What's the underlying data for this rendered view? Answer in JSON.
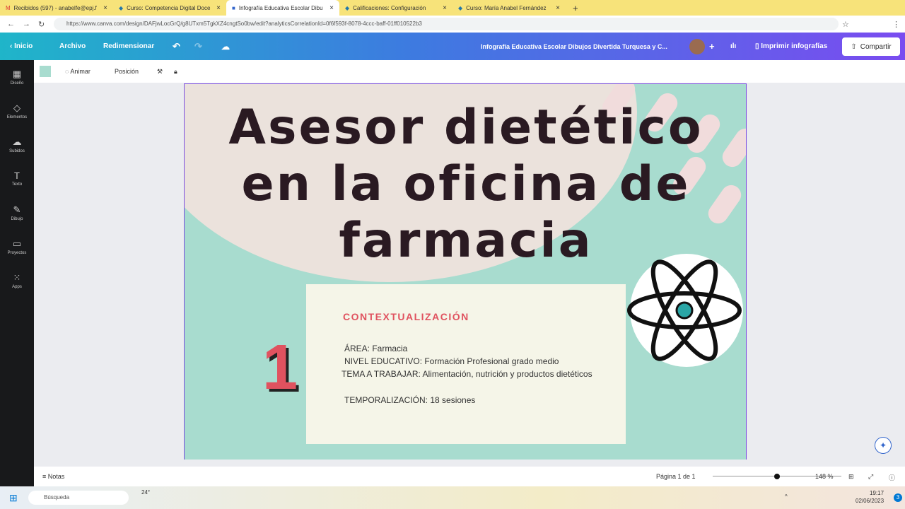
{
  "browser": {
    "tabs": [
      {
        "title": "Recibidos (597) - anabelfe@epj.f",
        "icon": "gmail-icon"
      },
      {
        "title": "Curso: Competencia Digital Doce",
        "icon": "moodle-icon"
      },
      {
        "title": "Infografía Educativa Escolar Dibu",
        "icon": "canva-icon",
        "active": true
      },
      {
        "title": "Calificaciones: Configuración",
        "icon": "moodle-icon"
      },
      {
        "title": "Curso: María Anabel Fernández",
        "icon": "moodle-icon"
      }
    ],
    "url": "https://www.canva.com/design/DAFjwLocGrQ/g8UTxm5TgkXZ4cngtSo0bw/edit?analyticsCorrelationId=0f6f593f-8078-4ccc-baff-01ff010522b3"
  },
  "nav": {
    "home": "Inicio",
    "file": "Archivo",
    "resize": "Redimensionar",
    "doc_title": "Infografía Educativa Escolar Dibujos Divertida Turquesa y C...",
    "print": "Imprimir infografías",
    "share": "Compartir"
  },
  "sidebar": [
    "Diseño",
    "Elementos",
    "Subidos",
    "Texto",
    "Dibujo",
    "Proyectos",
    "Apps"
  ],
  "toolbar": {
    "animate": "Animar",
    "position": "Posición",
    "color": "#a8dccf"
  },
  "design": {
    "title_lines": [
      "Asesor dietético",
      "en la oficina de",
      "farmacia"
    ],
    "number": "1",
    "heading": "CONTEXTUALIZACIÓN",
    "lines": [
      "ÁREA:     Farmacia",
      "NIVEL EDUCATIVO: Formación Profesional grado medio",
      "TEMA A TRABAJAR: Alimentación, nutrición y productos dietéticos",
      "TEMPORALIZACIÓN: 18 sesiones"
    ]
  },
  "footer": {
    "notes": "Notas",
    "page": "Página 1 de 1",
    "zoom": "148 %",
    "zoom_fraction": 0.5
  },
  "taskbar": {
    "search": "Búsqueda",
    "temp": "24°",
    "time": "19:17",
    "date": "02/06/2023",
    "badge": "3"
  }
}
